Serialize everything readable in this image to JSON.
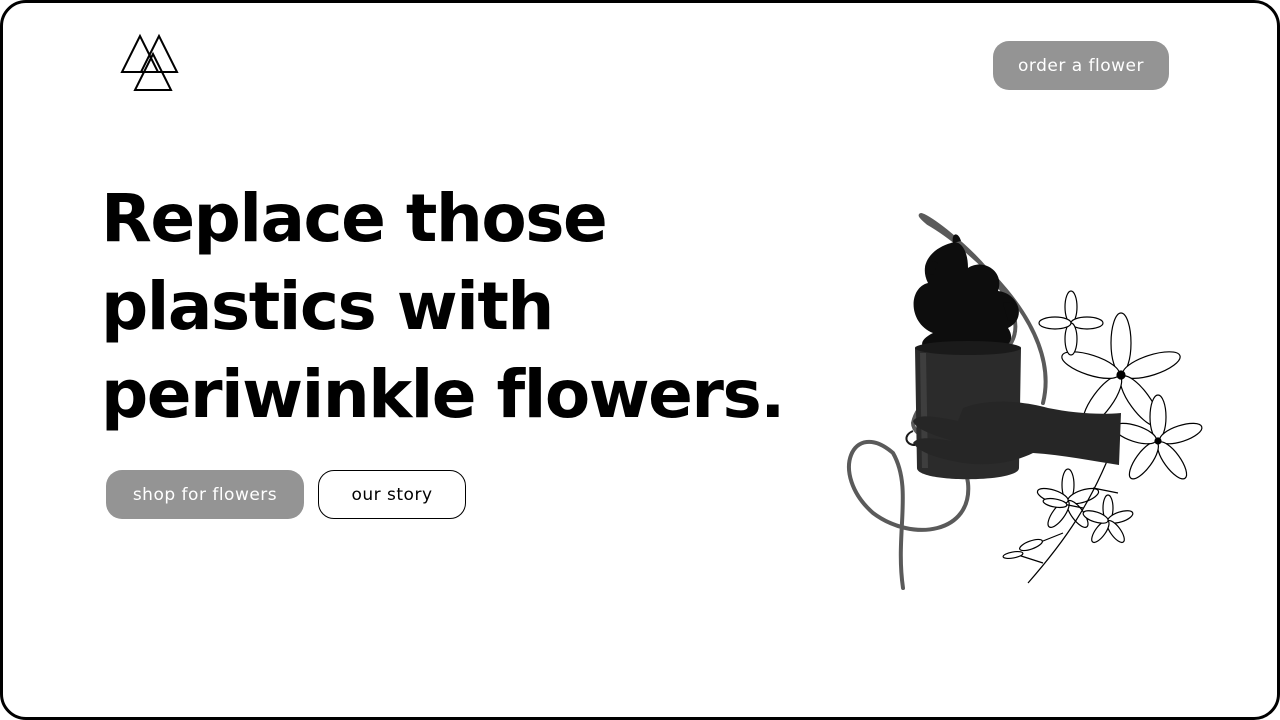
{
  "header": {
    "logo_icon": "triple-triangle-logo-icon",
    "order_button_label": "order a flower"
  },
  "hero": {
    "headline_lines": [
      "Replace those",
      "plastics with",
      "periwinkle flowers."
    ],
    "primary_button_label": "shop for flowers",
    "secondary_button_label": "our story",
    "illustration": "hand-holding-potted-plant-with-line-art-flowers"
  },
  "colors": {
    "button_gray": "#949494",
    "text": "#000000",
    "background": "#ffffff"
  }
}
